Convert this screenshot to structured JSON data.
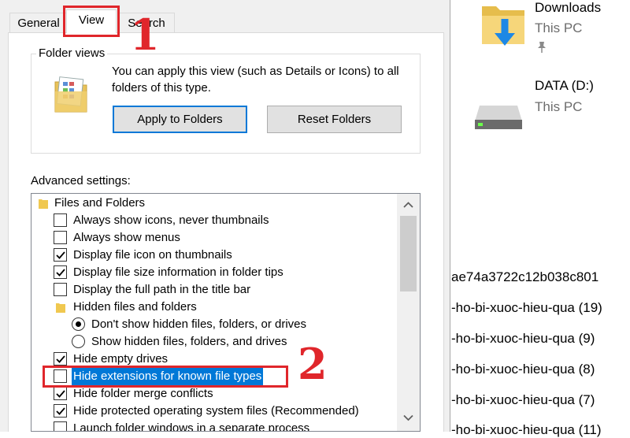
{
  "dialog": {
    "tabs": [
      {
        "label": "General"
      },
      {
        "label": "View"
      },
      {
        "label": "Search"
      }
    ],
    "folder_views": {
      "title": "Folder views",
      "description": "You can apply this view (such as Details or Icons) to all folders of this type.",
      "apply_label": "Apply to Folders",
      "reset_label": "Reset Folders"
    },
    "advanced_label": "Advanced settings:",
    "tree": [
      {
        "type": "folder",
        "label": "Files and Folders"
      },
      {
        "type": "checkbox",
        "label": "Always show icons, never thumbnails",
        "checked": false
      },
      {
        "type": "checkbox",
        "label": "Always show menus",
        "checked": false
      },
      {
        "type": "checkbox",
        "label": "Display file icon on thumbnails",
        "checked": true
      },
      {
        "type": "checkbox",
        "label": "Display file size information in folder tips",
        "checked": true
      },
      {
        "type": "checkbox",
        "label": "Display the full path in the title bar",
        "checked": false
      },
      {
        "type": "folder",
        "label": "Hidden files and folders"
      },
      {
        "type": "radio",
        "label": "Don't show hidden files, folders, or drives",
        "checked": true
      },
      {
        "type": "radio",
        "label": "Show hidden files, folders, and drives",
        "checked": false
      },
      {
        "type": "checkbox",
        "label": "Hide empty drives",
        "checked": true
      },
      {
        "type": "checkbox",
        "label": "Hide extensions for known file types",
        "checked": false,
        "selected": true
      },
      {
        "type": "checkbox",
        "label": "Hide folder merge conflicts",
        "checked": true
      },
      {
        "type": "checkbox",
        "label": "Hide protected operating system files (Recommended)",
        "checked": true
      },
      {
        "type": "checkbox",
        "label": "Launch folder windows in a separate process",
        "checked": false
      }
    ]
  },
  "annotations": {
    "marker_1": "1",
    "marker_2": "2",
    "color": "#e0262b"
  },
  "explorer": {
    "items": [
      {
        "title": "Downloads",
        "subtitle": "This PC",
        "icon": "download-folder-icon"
      },
      {
        "title": "DATA (D:)",
        "subtitle": "This PC",
        "icon": "drive-icon"
      }
    ],
    "files": [
      "ae74a3722c12b038c801",
      "-ho-bi-xuoc-hieu-qua (19)",
      "-ho-bi-xuoc-hieu-qua (9)",
      "-ho-bi-xuoc-hieu-qua (8)",
      "-ho-bi-xuoc-hieu-qua (7)",
      "-ho-bi-xuoc-hieu-qua (11)"
    ]
  },
  "colors": {
    "accent": "#0078d7",
    "dialog_bg": "#f0f0f0",
    "annotation": "#e0262b"
  }
}
